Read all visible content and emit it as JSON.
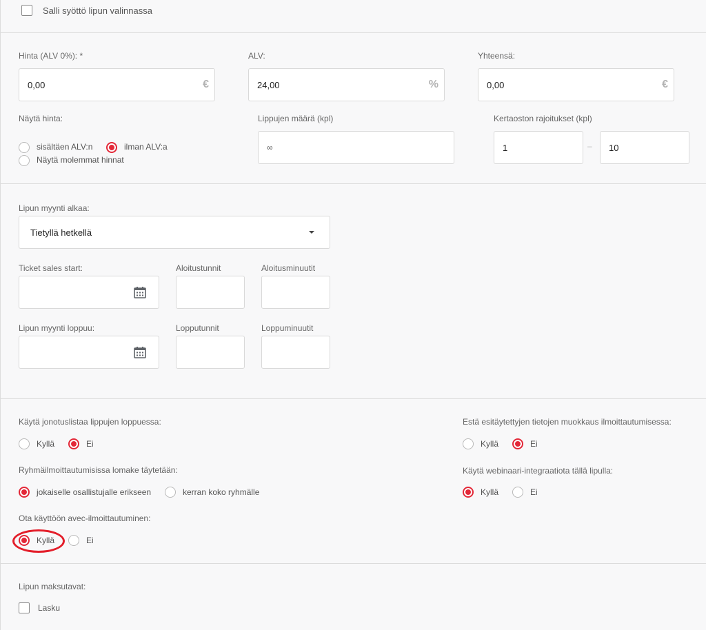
{
  "top": {
    "allow_input_label": "Salli syöttö lipun valinnassa"
  },
  "price": {
    "price_label": "Hinta (ALV 0%): *",
    "price_value": "0,00",
    "price_unit": "€",
    "vat_label": "ALV:",
    "vat_value": "24,00",
    "vat_unit": "%",
    "total_label": "Yhteensä:",
    "total_value": "0,00",
    "total_unit": "€"
  },
  "display": {
    "label": "Näytä hinta:",
    "options": [
      "sisältäen ALV:n",
      "ilman ALV:a",
      "Näytä molemmat hinnat"
    ],
    "selected": "ilman ALV:a"
  },
  "quantity": {
    "label": "Lippujen määrä (kpl)",
    "value": "∞"
  },
  "limits": {
    "label": "Kertaoston rajoitukset (kpl)",
    "min": "1",
    "separator": "–",
    "max": "10"
  },
  "sales": {
    "start_mode_label": "Lipun myynti alkaa:",
    "start_mode_value": "Tietyllä hetkellä",
    "start_label": "Ticket sales start:",
    "start_hours_label": "Aloitustunnit",
    "start_minutes_label": "Aloitusminuutit",
    "end_label": "Lipun myynti loppuu:",
    "end_hours_label": "Lopputunnit",
    "end_minutes_label": "Loppuminuutit"
  },
  "options": {
    "waitlist": {
      "label": "Käytä jonotuslistaa lippujen loppuessa:",
      "yes": "Kyllä",
      "no": "Ei",
      "selected": "Ei"
    },
    "prefill_lock": {
      "label": "Estä esitäytettyjen tietojen muokkaus ilmoittautumisessa:",
      "yes": "Kyllä",
      "no": "Ei",
      "selected": "Ei"
    },
    "group_form": {
      "label": "Ryhmäilmoittautumisissa lomake täytetään:",
      "each": "jokaiselle osallistujalle erikseen",
      "once": "kerran koko ryhmälle",
      "selected": "jokaiselle osallistujalle erikseen"
    },
    "webinar": {
      "label": "Käytä webinaari-integraatiota tällä lipulla:",
      "yes": "Kyllä",
      "no": "Ei",
      "selected": "Kyllä"
    },
    "avec": {
      "label": "Ota käyttöön avec-ilmoittautuminen:",
      "yes": "Kyllä",
      "no": "Ei",
      "selected": "Kyllä"
    }
  },
  "payment": {
    "label": "Lipun maksutavat:",
    "invoice": "Lasku"
  },
  "colors": {
    "accent": "#e32838",
    "background": "#f8f8f9"
  },
  "icons": {
    "calendar": "calendar-icon",
    "dropdown": "chevron-down-icon"
  }
}
